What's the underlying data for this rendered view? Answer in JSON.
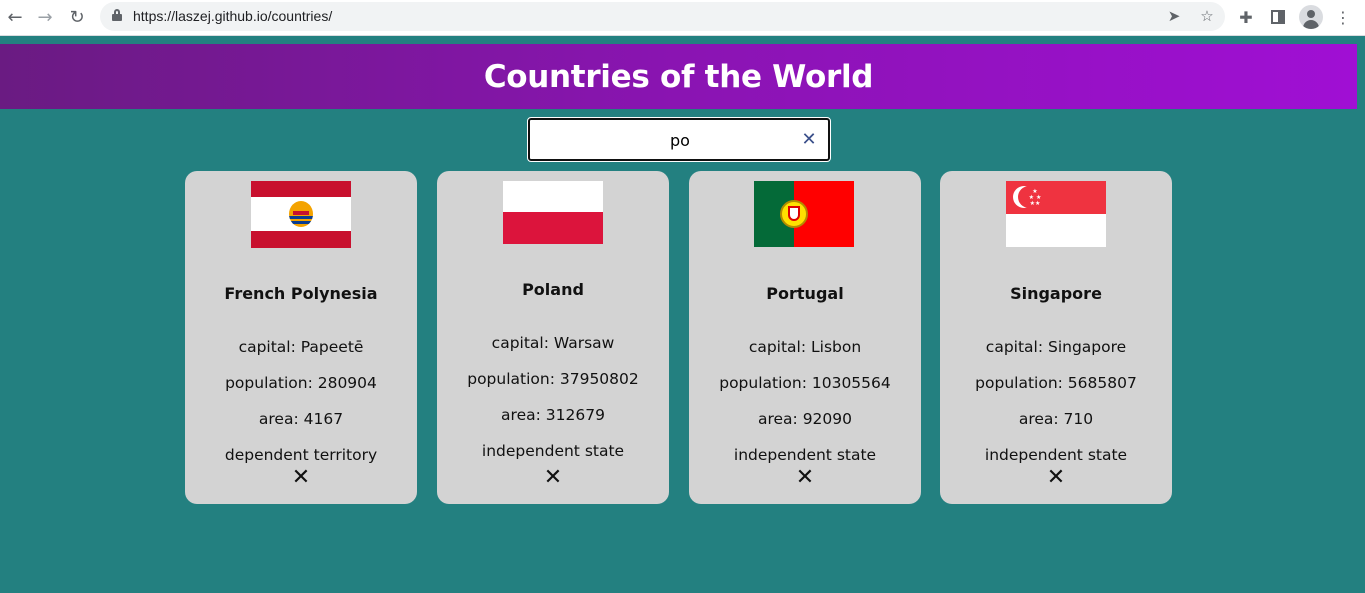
{
  "browser": {
    "url": "https://laszej.github.io/countries/"
  },
  "header": {
    "title": "Countries of the World"
  },
  "search": {
    "value": "po",
    "clear_icon": "close-icon"
  },
  "cards": [
    {
      "name": "French Polynesia",
      "capital": "capital: Papeetē",
      "population": "population: 280904",
      "area": "area: 4167",
      "status": "dependent territory",
      "flag": "flag-french-polynesia"
    },
    {
      "name": "Poland",
      "capital": "capital: Warsaw",
      "population": "population: 37950802",
      "area": "area: 312679",
      "status": "independent state",
      "flag": "flag-poland"
    },
    {
      "name": "Portugal",
      "capital": "capital: Lisbon",
      "population": "population: 10305564",
      "area": "area: 92090",
      "status": "independent state",
      "flag": "flag-portugal"
    },
    {
      "name": "Singapore",
      "capital": "capital: Singapore",
      "population": "population: 5685807",
      "area": "area: 710",
      "status": "independent state",
      "flag": "flag-singapore"
    }
  ],
  "remove_label": "✕",
  "colors": {
    "background": "#238080",
    "card": "#d3d3d3",
    "header_start": "#6a1b82",
    "header_end": "#a00fd4"
  }
}
